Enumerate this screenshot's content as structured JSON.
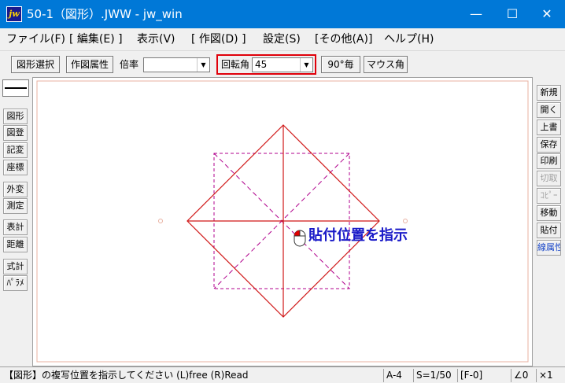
{
  "window": {
    "title": "50-1（図形）.JWW - jw_win",
    "app_icon_text": "jw",
    "minimize_glyph": "—",
    "maximize_glyph": "☐",
    "close_glyph": "✕"
  },
  "menu": [
    "ファイル(F)",
    "[ 編集(E) ]",
    "表示(V)",
    "[ 作図(D) ]",
    "設定(S)",
    "[その他(A)]",
    "ヘルプ(H)"
  ],
  "toolbar": {
    "select_shape": "図形選択",
    "draw_attr": "作図属性",
    "scale_label": "倍率",
    "scale_value": "",
    "rotation_label": "回転角",
    "rotation_value": "45",
    "deg90": "90°毎",
    "mouse_angle": "マウス角",
    "dropdown_glyph": "▼"
  },
  "left_tools": [
    "図形",
    "図登",
    "記変",
    "座標",
    "外変",
    "測定",
    "表計",
    "距離",
    "式計",
    "ﾊﾟﾗﾒ"
  ],
  "right_tools": [
    {
      "label": "新規",
      "state": "normal"
    },
    {
      "label": "開く",
      "state": "normal"
    },
    {
      "label": "上書",
      "state": "normal"
    },
    {
      "label": "保存",
      "state": "normal"
    },
    {
      "label": "印刷",
      "state": "normal"
    },
    {
      "label": "切取",
      "state": "disabled"
    },
    {
      "label": "ｺﾋﾟｰ",
      "state": "disabled"
    },
    {
      "label": "移動",
      "state": "normal"
    },
    {
      "label": "貼付",
      "state": "normal"
    },
    {
      "label": "線属性",
      "state": "active"
    }
  ],
  "canvas": {
    "hint": "貼付位置を指示",
    "colors": {
      "solid": "#d01818",
      "dashed": "#b0008c",
      "frame": "#e8b0a0"
    }
  },
  "status": {
    "message": "【図形】の複写位置を指示してください (L)free (R)Read",
    "paper": "A-4",
    "scale": "S=1/50",
    "layer": "[F-0]",
    "angle": "∠0",
    "zoom": "×1"
  }
}
